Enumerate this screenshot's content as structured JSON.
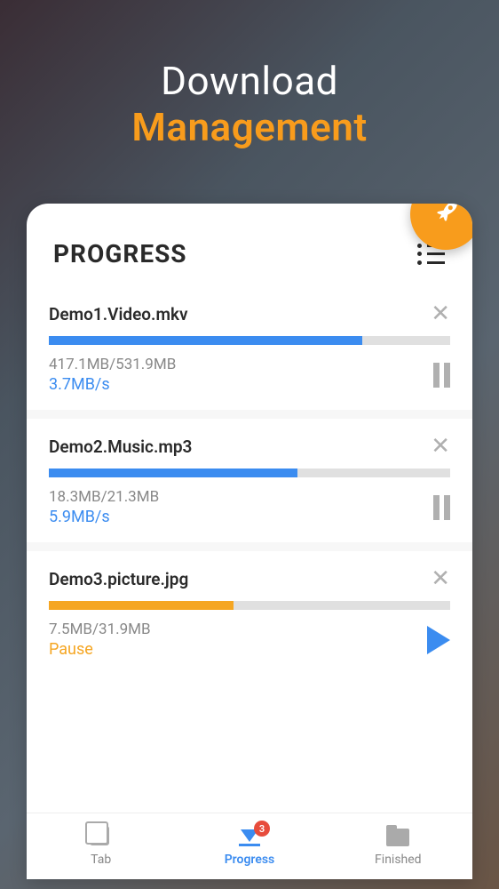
{
  "header": {
    "line1": "Download",
    "line2": "Management"
  },
  "card": {
    "title": "PROGRESS"
  },
  "downloads": [
    {
      "name": "Demo1.Video.mkv",
      "progress_percent": 78,
      "size": "417.1MB/531.9MB",
      "speed": "3.7MB/s",
      "status": "downloading",
      "color": "blue"
    },
    {
      "name": "Demo2.Music.mp3",
      "progress_percent": 62,
      "size": "18.3MB/21.3MB",
      "speed": "5.9MB/s",
      "status": "downloading",
      "color": "blue"
    },
    {
      "name": "Demo3.picture.jpg",
      "progress_percent": 46,
      "size": "7.5MB/31.9MB",
      "speed": "Pause",
      "status": "paused",
      "color": "orange"
    }
  ],
  "nav": {
    "items": [
      {
        "label": "Tab",
        "active": false
      },
      {
        "label": "Progress",
        "active": true,
        "badge": "3"
      },
      {
        "label": "Finished",
        "active": false
      }
    ]
  }
}
